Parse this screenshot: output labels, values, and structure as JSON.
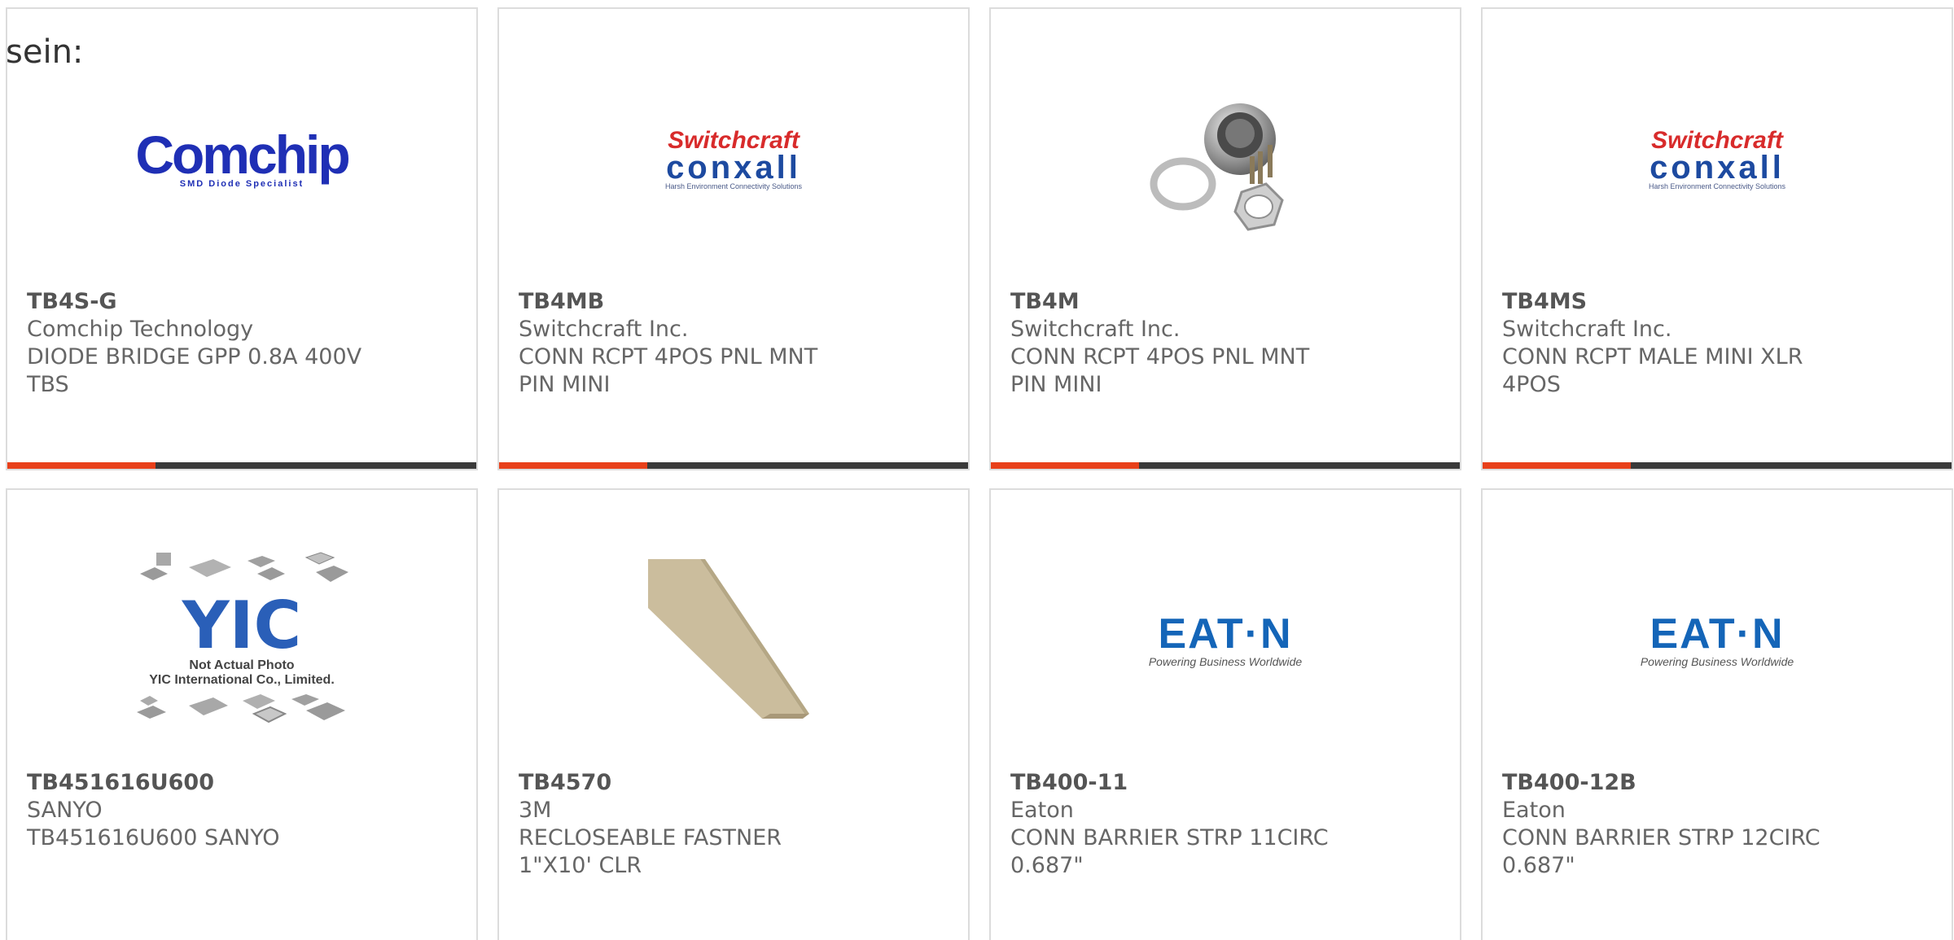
{
  "intro_text": "sein:",
  "products": [
    {
      "part": "TB4S-G",
      "manufacturer": "Comchip Technology",
      "description": "DIODE BRIDGE GPP 0.8A 400V TBS",
      "image": "comchip-logo",
      "logo": {
        "main": "Comchip",
        "sub": "SMD Diode Specialist"
      }
    },
    {
      "part": "TB4MB",
      "manufacturer": "Switchcraft Inc.",
      "description": "CONN RCPT 4POS PNL MNT PIN MINI",
      "image": "switchcraft-logo",
      "logo": {
        "main": "Switchcraft",
        "sub": "conxall",
        "tag": "Harsh Environment Connectivity Solutions"
      }
    },
    {
      "part": "TB4M",
      "manufacturer": "Switchcraft Inc.",
      "description": "CONN RCPT 4POS PNL MNT PIN MINI",
      "image": "connector-photo"
    },
    {
      "part": "TB4MS",
      "manufacturer": "Switchcraft Inc.",
      "description": "CONN RCPT MALE MINI XLR 4POS",
      "image": "switchcraft-logo",
      "logo": {
        "main": "Switchcraft",
        "sub": "conxall",
        "tag": "Harsh Environment Connectivity Solutions"
      }
    },
    {
      "part": "TB451616U600",
      "manufacturer": "SANYO",
      "description": "TB451616U600 SANYO",
      "image": "yic-placeholder",
      "logo": {
        "main": "YIC",
        "line1": "Not Actual Photo",
        "line2": "YIC International Co., Limited."
      }
    },
    {
      "part": "TB4570",
      "manufacturer": "3M",
      "description": "RECLOSEABLE FASTNER 1\"X10' CLR",
      "image": "tape-photo"
    },
    {
      "part": "TB400-11",
      "manufacturer": "Eaton",
      "description": "CONN BARRIER STRP 11CIRC 0.687\"",
      "image": "eaton-logo",
      "logo": {
        "main": "EAT·N",
        "sub": "Powering Business Worldwide"
      }
    },
    {
      "part": "TB400-12B",
      "manufacturer": "Eaton",
      "description": "CONN BARRIER STRP 12CIRC 0.687\"",
      "image": "eaton-logo",
      "logo": {
        "main": "EAT·N",
        "sub": "Powering Business Worldwide"
      }
    }
  ],
  "colors": {
    "accent": "#e8401a",
    "bar": "#3a3a3a",
    "border": "#dcdcdc",
    "text": "#666666"
  }
}
